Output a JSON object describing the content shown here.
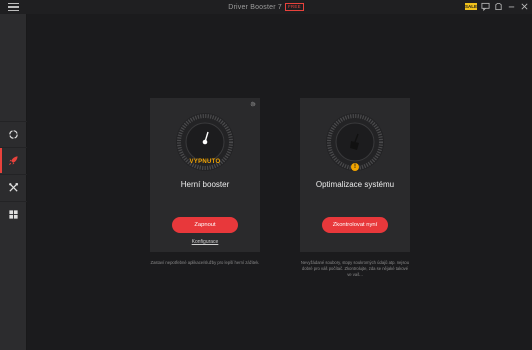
{
  "titlebar": {
    "title": "Driver Booster 7",
    "edition_badge": "FREE",
    "sale_badge": "SALE",
    "icons": [
      "menu-icon",
      "sale-icon",
      "feedback-icon",
      "skin-icon",
      "minimize-icon",
      "close-icon"
    ]
  },
  "sidebar": {
    "items": [
      {
        "icon": "scan-icon",
        "active": false
      },
      {
        "icon": "boost-rocket-icon",
        "active": true
      },
      {
        "icon": "tools-icon",
        "active": false
      },
      {
        "icon": "action-center-icon",
        "active": false
      }
    ]
  },
  "cards": {
    "game_boost": {
      "status": "VYPNUTO",
      "title": "Herní booster",
      "button": "Zapnout",
      "link": "Konfigurace",
      "description": "Zastaví nepotřebné aplikace/služby pro lepší herní zážitek.",
      "status_color": "#f2a400"
    },
    "system_optimize": {
      "title": "Optimalizace systému",
      "button": "Zkontrolovat nyní",
      "warning": "!",
      "description": "Nevyžádané soubory, stopy soukromých údajů atp. nejsou dobré pro váš počítač. Zkontrolujte, zda se nějaké takové ve vaš..."
    }
  },
  "colors": {
    "accent": "#e8383b",
    "warning": "#f2a400",
    "background": "#1b1b1d",
    "card": "#2a2a2c"
  }
}
